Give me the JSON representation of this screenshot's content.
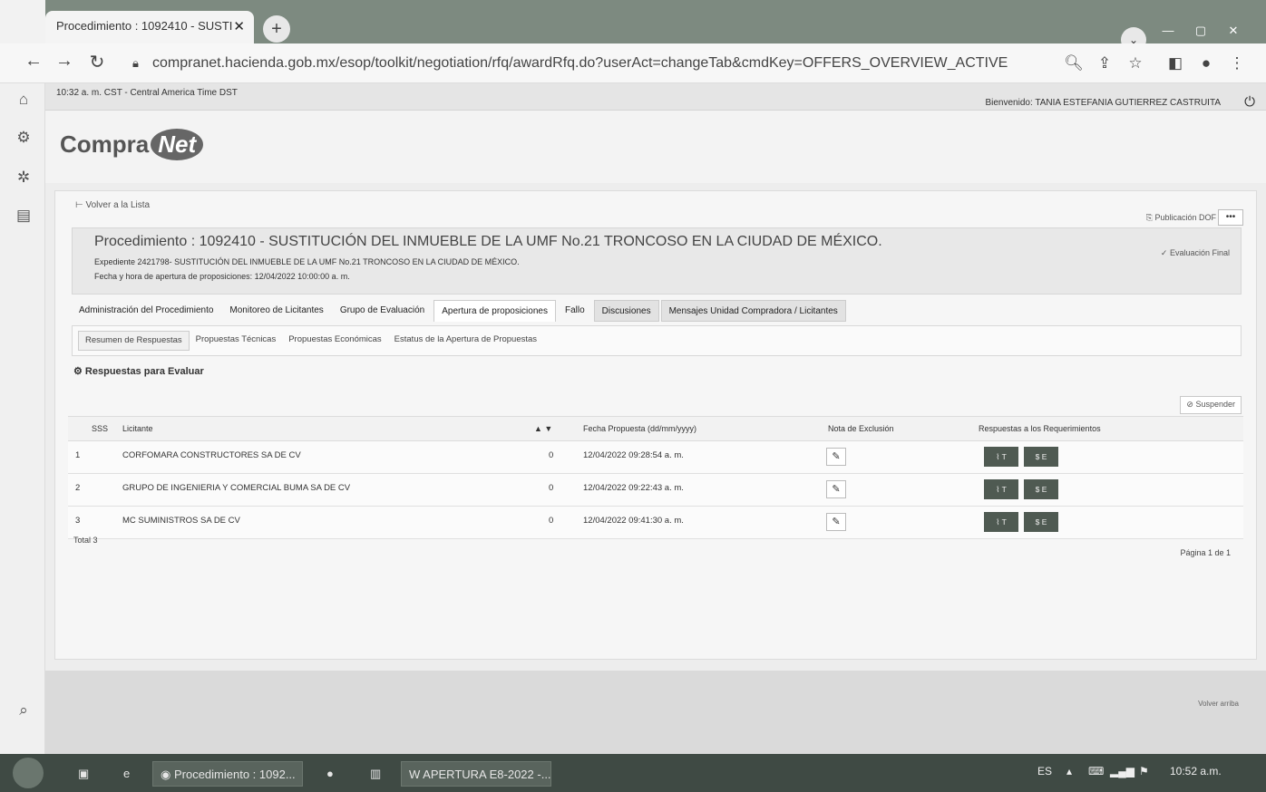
{
  "browser": {
    "tab_title": "Procedimiento : 1092410 - SUSTI",
    "tab_close": "✕",
    "new_tab": "+",
    "url": "compranet.hacienda.gob.mx/esop/toolkit/negotiation/rfq/awardRfq.do?userAct=changeTab&cmdKey=OFFERS_OVERVIEW_ACTIVE"
  },
  "topbar": {
    "time": "10:32 a. m. CST - Central America Time DST",
    "welcome": "Bienvenido: TANIA ESTEFANIA GUTIERREZ CASTRUITA"
  },
  "logo": {
    "text": "Compra",
    "net": "Net"
  },
  "card": {
    "back_link": "Volver a la Lista",
    "dof": "Publicación DOF",
    "more": "•••",
    "title": "Procedimiento : 1092410 - SUSTITUCIÓN DEL INMUEBLE DE LA UMF No.21 TRONCOSO EN LA CIUDAD DE MÉXICO.",
    "expediente": "Expediente 2421798- SUSTITUCIÓN DEL INMUEBLE DE LA UMF No.21 TRONCOSO EN LA CIUDAD DE MÉXICO.",
    "fecha_apertura": "Fecha y hora de apertura de proposiciones: 12/04/2022 10:00:00 a. m.",
    "eval_final": "Evaluación Final"
  },
  "tabs": [
    "Administración del Procedimiento",
    "Monitoreo de Licitantes",
    "Grupo de Evaluación",
    "Apertura de proposiciones",
    "Fallo",
    "Discusiones",
    "Mensajes Unidad Compradora / Licitantes"
  ],
  "subtabs": [
    "Resumen de Respuestas",
    "Propuestas Técnicas",
    "Propuestas Económicas",
    "Estatus de la Apertura de Propuestas"
  ],
  "section_title": "Respuestas para Evaluar",
  "suspend_label": "Suspender",
  "table": {
    "headers": {
      "num": "SSS",
      "licitante": "Licitante",
      "sort": "▲ ▼",
      "fecha": "Fecha Propuesta (dd/mm/yyyy)",
      "nota": "Nota de Exclusión",
      "respuestas": "Respuestas a los Requerimientos"
    },
    "rows": [
      {
        "num": "1",
        "licitante": "CORFOMARA CONSTRUCTORES SA DE CV",
        "zero": "0",
        "fecha": "12/04/2022 09:28:54 a. m."
      },
      {
        "num": "2",
        "licitante": "GRUPO DE INGENIERIA Y COMERCIAL BUMA SA DE CV",
        "zero": "0",
        "fecha": "12/04/2022 09:22:43 a. m."
      },
      {
        "num": "3",
        "licitante": "MC SUMINISTROS SA DE CV",
        "zero": "0",
        "fecha": "12/04/2022 09:41:30 a. m."
      }
    ],
    "btn_t": "T",
    "btn_e": "E",
    "total": "Total 3",
    "pager": "Página 1 de 1"
  },
  "back_to_top": "Volver arriba",
  "taskbar": {
    "item_browser": "Procedimiento : 1092...",
    "item_word": "APERTURA E8-2022 -...",
    "lang": "ES",
    "clock": "10:52 a.m."
  },
  "colors": {
    "accent_dark": "#4f5a52",
    "taskbar": "#3f4a44"
  }
}
